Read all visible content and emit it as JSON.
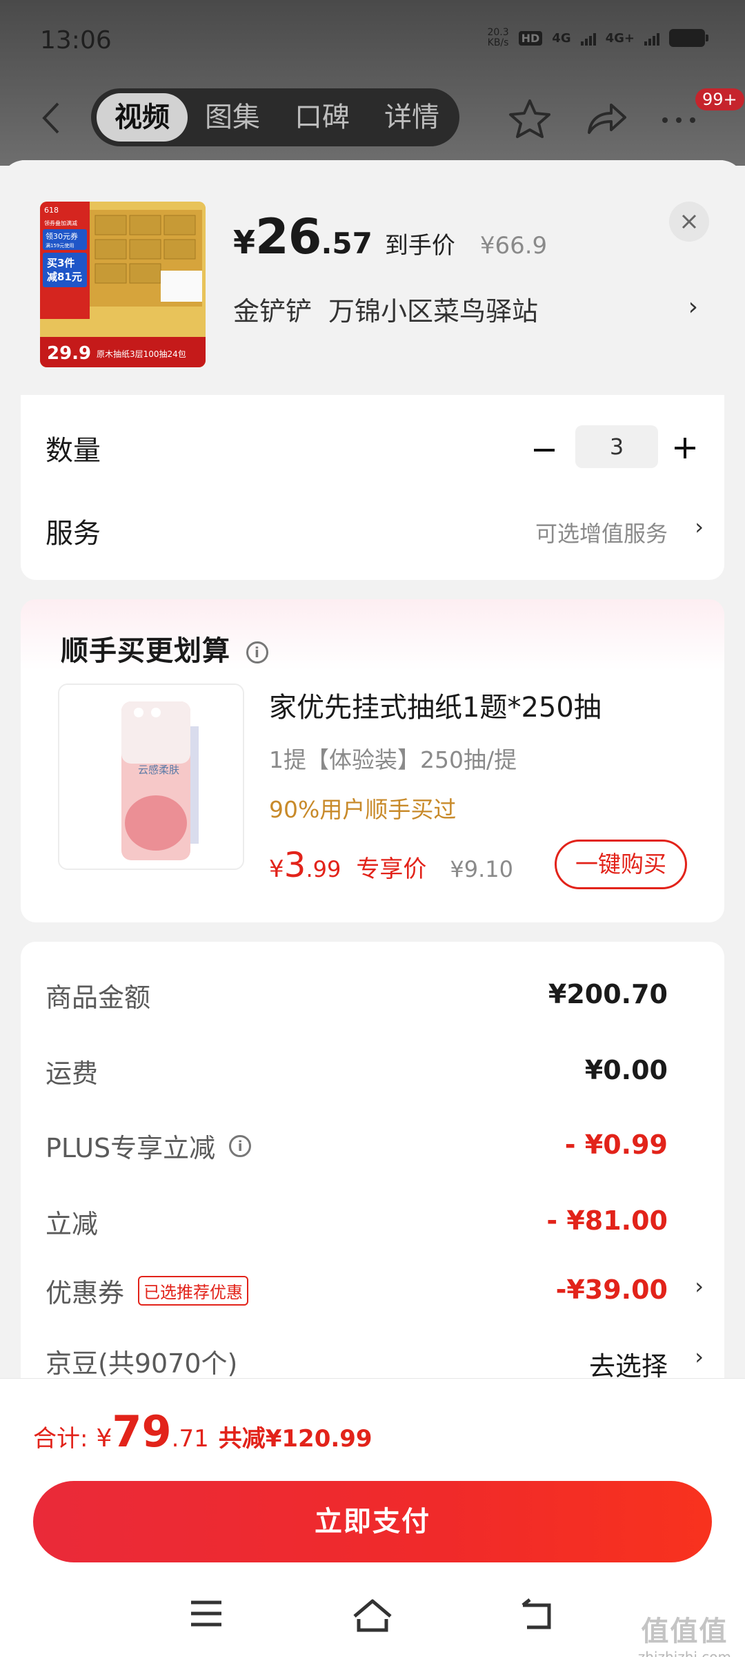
{
  "status": {
    "time": "13:06",
    "net_speed_value": "20.3",
    "net_speed_unit": "KB/s",
    "hd_label": "HD",
    "hd_sub": "1 2",
    "net1": "4G",
    "net2": "4G+"
  },
  "nav": {
    "tabs": [
      {
        "label": "视频"
      },
      {
        "label": "图集"
      },
      {
        "label": "口碑"
      },
      {
        "label": "详情"
      }
    ],
    "badge": "99+"
  },
  "product": {
    "price_symbol": "¥",
    "price_int": "26",
    "price_dec": ".57",
    "price_tag": "到手价",
    "original_price": "¥66.9",
    "address_name": "金铲铲",
    "address_place": "万锦小区菜鸟驿站",
    "thumb_texts": {
      "top_badge": "618",
      "coupon_line1": "领券叠加满减",
      "coupon_line2": "领30元券",
      "coupon_line3": "满159元使用",
      "buy3_line1": "买3件",
      "buy3_line2": "减81元",
      "bottom_price": "29.9",
      "bottom_desc": "原木抽纸3层100抽24包"
    }
  },
  "quantity": {
    "label": "数量",
    "value": "3"
  },
  "service": {
    "label": "服务",
    "hint": "可选增值服务"
  },
  "addon": {
    "title": "顺手买更划算",
    "name": "家优先挂式抽纸1题*250抽",
    "spec": "1提【体验装】250抽/提",
    "social": "90%用户顺手买过",
    "price_symbol": "¥",
    "price_int": "3",
    "price_dec": ".99",
    "price_tag": "专享价",
    "original_price": "¥9.10",
    "buy_label": "一键购买",
    "thumb_text": "云感柔肤"
  },
  "summary": {
    "rows": [
      {
        "label": "商品金额",
        "value": "¥200.70"
      },
      {
        "label": "运费",
        "value": "¥0.00"
      },
      {
        "label": "PLUS专享立减",
        "value": "- ¥0.99"
      },
      {
        "label": "立减",
        "value": "- ¥81.00"
      },
      {
        "label": "优惠券",
        "tag": "已选推荐优惠",
        "value": "-¥39.00"
      },
      {
        "label": "京豆(共9070个)",
        "value": "去选择"
      }
    ]
  },
  "footer": {
    "total_label": "合计:",
    "total_symbol": "¥",
    "total_int": "79",
    "total_dec": ".71",
    "saved": "共减¥120.99",
    "pay_label": "立即支付"
  },
  "watermark": {
    "main": "值值值",
    "url": "zhizhizhi.com"
  },
  "colors": {
    "accent_red": "#e2231a",
    "social_orange": "#c88a2a"
  }
}
